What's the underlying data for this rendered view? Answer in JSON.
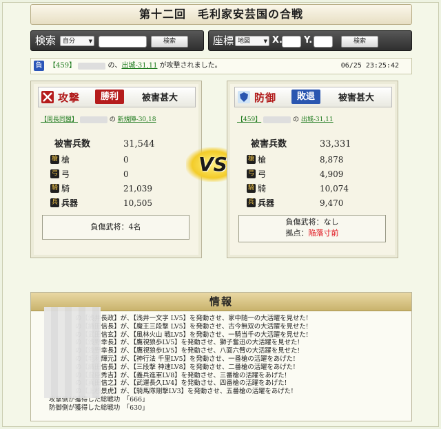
{
  "title": "第十二回　毛利家安芸国の合戦",
  "search": {
    "label": "検索",
    "select_value": "自分",
    "button": "検索"
  },
  "coords": {
    "label": "座標",
    "select_value": "地図",
    "x_label": "X.",
    "y_label": "Y.",
    "button": "検索"
  },
  "notice": {
    "badge": "負",
    "alliance": "【459】",
    "connector": "の",
    "target": "出城-31,11",
    "message": "が攻撃されました。",
    "time": "06/25 23:25:42"
  },
  "attack": {
    "kind": "攻撃",
    "result": "勝利",
    "damage": "被害甚大",
    "owner_alliance": "【周長同盟】",
    "owner_connector": "の",
    "base": "新規陣-30,18",
    "total_label": "被害兵数",
    "total": "31,544",
    "rows": [
      {
        "icon": "槍",
        "name": "槍",
        "value": "0"
      },
      {
        "icon": "弓",
        "name": "弓",
        "value": "0"
      },
      {
        "icon": "騎",
        "name": "騎",
        "value": "21,039"
      },
      {
        "icon": "兵",
        "name": "兵器",
        "value": "10,505"
      }
    ],
    "injured": "負傷武将：4名"
  },
  "defense": {
    "kind": "防御",
    "result": "敗退",
    "damage": "被害甚大",
    "owner_alliance": "【459】",
    "owner_connector": "の",
    "base": "出城-31,11",
    "total_label": "被害兵数",
    "total": "33,331",
    "rows": [
      {
        "icon": "槍",
        "name": "槍",
        "value": "8,878"
      },
      {
        "icon": "弓",
        "name": "弓",
        "value": "4,909"
      },
      {
        "icon": "騎",
        "name": "騎",
        "value": "10,074"
      },
      {
        "icon": "兵",
        "name": "兵器",
        "value": "9,470"
      }
    ],
    "injured": "負傷武将：なし",
    "base_label": "拠点：",
    "base_status": "陥落寸前"
  },
  "vs": "VS",
  "info": {
    "heading": "情報",
    "lines": [
      "の【浅井長政】が、【浅井一文字 LV5】を発動させ、家中随一の大活躍を見せた!",
      "の【織田信長】が、【魔王三段撃 LV5】を発動させ、古今無双の大活躍を見せた!",
      "の【武田信玄】が、【風林火山 戦LV5】を発動させ、一騎当千の大活躍を見せた!",
      "の【浅野幸長】が、【鷹視狼歩LV5】を発動させ、獅子奮迅の大活躍を見せた!",
      "の【浅野幸長】が、【鷹視狼歩LV5】を発動させ、八面六臂の大活躍を見せた!",
      "の【毛利輝元】が、【神行法 千里LV5】を発動させ、一番槍の活躍をあげた!",
      "の【織田信長】が、【三段撃 神速LV8】を発動させ、二番槍の活躍をあげた!",
      "の【豊臣秀吉】が、【義兵進軍LV8】を発動させ、三番槍の活躍をあげた!",
      "の【真田信之】が、【武運長久LV4】を発動させ、四番槍の活躍をあげた!",
      "の【上杉景虎】が、【騎馬隊剛撃LV3】を発動させ、五番槍の活躍をあげた!"
    ],
    "atk_total": "攻撃側が獲得した総戦功　「666」",
    "def_total": "防御側が獲得した総戦功　「630」"
  },
  "colors": {
    "win": "#b51c1c",
    "lose": "#2a56b0",
    "alert": "#e0101a",
    "link": "#1d7a1d"
  }
}
